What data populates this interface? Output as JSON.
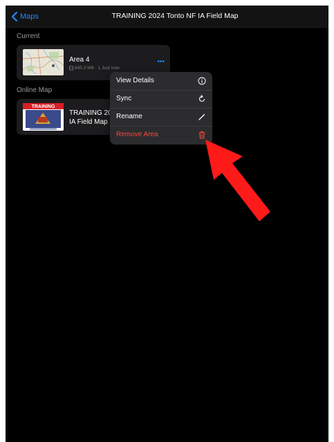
{
  "navbar": {
    "back_label": "Maps",
    "title": "TRAINING 2024 Tonto NF IA Field Map"
  },
  "sections": {
    "current_label": "Current",
    "online_label": "Online Map"
  },
  "current_area": {
    "name": "Area 4",
    "meta": "845.3 MB · 1⁠ Just now",
    "more_label": "•••"
  },
  "online_map": {
    "title_line1": "TRAINING 20",
    "title_line2": "IA Field Map",
    "thumb_banner": "TRAINING"
  },
  "context_menu": {
    "items": [
      {
        "label": "View Details",
        "icon": "info-icon"
      },
      {
        "label": "Sync",
        "icon": "sync-icon"
      },
      {
        "label": "Rename",
        "icon": "pencil-icon"
      },
      {
        "label": "Remove Area",
        "icon": "trash-icon"
      }
    ]
  },
  "colors": {
    "accent": "#1f8bff",
    "danger": "#ff453a",
    "annotation_arrow": "#ff1a1a"
  }
}
